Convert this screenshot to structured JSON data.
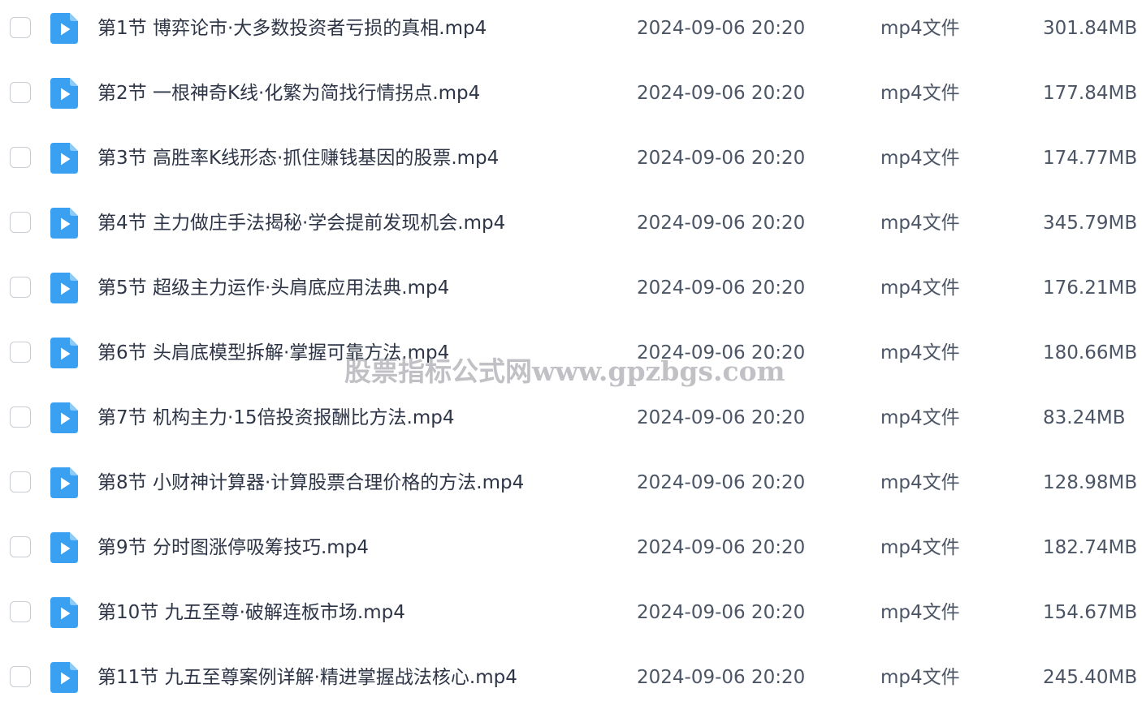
{
  "files": [
    {
      "name": "第1节 博弈论市·大多数投资者亏损的真相.mp4",
      "date": "2024-09-06 20:20",
      "type": "mp4文件",
      "size": "301.84MB",
      "icon": "video-file-icon"
    },
    {
      "name": "第2节 一根神奇K线·化繁为简找行情拐点.mp4",
      "date": "2024-09-06 20:20",
      "type": "mp4文件",
      "size": "177.84MB",
      "icon": "video-file-icon"
    },
    {
      "name": "第3节 高胜率K线形态·抓住赚钱基因的股票.mp4",
      "date": "2024-09-06 20:20",
      "type": "mp4文件",
      "size": "174.77MB",
      "icon": "video-file-icon"
    },
    {
      "name": "第4节 主力做庄手法揭秘·学会提前发现机会.mp4",
      "date": "2024-09-06 20:20",
      "type": "mp4文件",
      "size": "345.79MB",
      "icon": "video-file-icon"
    },
    {
      "name": "第5节 超级主力运作·头肩底应用法典.mp4",
      "date": "2024-09-06 20:20",
      "type": "mp4文件",
      "size": "176.21MB",
      "icon": "video-file-icon"
    },
    {
      "name": "第6节 头肩底模型拆解·掌握可靠方法.mp4",
      "date": "2024-09-06 20:20",
      "type": "mp4文件",
      "size": "180.66MB",
      "icon": "video-file-icon"
    },
    {
      "name": "第7节 机构主力·15倍投资报酬比方法.mp4",
      "date": "2024-09-06 20:20",
      "type": "mp4文件",
      "size": "83.24MB",
      "icon": "video-file-icon"
    },
    {
      "name": "第8节 小财神计算器·计算股票合理价格的方法.mp4",
      "date": "2024-09-06 20:20",
      "type": "mp4文件",
      "size": "128.98MB",
      "icon": "video-file-icon"
    },
    {
      "name": "第9节 分时图涨停吸筹技巧.mp4",
      "date": "2024-09-06 20:20",
      "type": "mp4文件",
      "size": "182.74MB",
      "icon": "video-file-icon"
    },
    {
      "name": "第10节 九五至尊·破解连板市场.mp4",
      "date": "2024-09-06 20:20",
      "type": "mp4文件",
      "size": "154.67MB",
      "icon": "video-file-icon"
    },
    {
      "name": "第11节 九五至尊案例详解·精进掌握战法核心.mp4",
      "date": "2024-09-06 20:20",
      "type": "mp4文件",
      "size": "245.40MB",
      "icon": "video-file-icon"
    }
  ],
  "watermark": "股票指标公式网www.gpzbgs.com",
  "colors": {
    "icon_blue": "#3aa0f2",
    "checkbox_border": "#c8ccd3",
    "text_primary": "#2e3547",
    "text_secondary": "#4b5565"
  }
}
